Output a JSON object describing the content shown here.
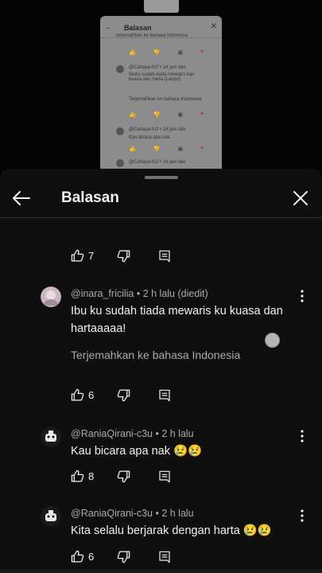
{
  "preview": {
    "title": "Balasan",
    "back_icon": "arrow-left-icon",
    "close_icon": "close-icon",
    "line_top": "terjemahkan ke bahasa Indonesia",
    "reply1_author": "@Cahaya-h1f • 14 jam lalu",
    "reply1_text": "Ibuku sudah tiada mewaris kan kuasa dan harta (Lanjut)",
    "reply1_translate": "Terjemahkan ke bahasa Indonesia",
    "reply2_author": "@Cahaya-h1f • 14 jam lalu",
    "reply2_text": "Kau bicara apa nak",
    "reply3_author": "@Cahaya-h1f • 14 jam lalu"
  },
  "sheet": {
    "title": "Balasan",
    "back_icon": "arrow-left-icon",
    "close_icon": "close-icon"
  },
  "top_actions": {
    "likes": "7"
  },
  "comments": [
    {
      "author": "@inara_fricilia • 2 h lalu (diedit)",
      "text": "Ibu ku sudah tiada mewaris ku kuasa dan hartaaaaa!",
      "translate": "Terjemahkan ke bahasa Indonesia",
      "likes": "6"
    },
    {
      "author": "@RaniaQirani-c3u • 2 h lalu",
      "text": "Kau bicara apa nak 😢😢",
      "likes": "8"
    },
    {
      "author": "@RaniaQirani-c3u • 2 h lalu",
      "text": "Kita selalu berjarak dengan harta 😢😢",
      "likes": "6"
    }
  ],
  "colors": {
    "background": "#0f0f0f",
    "text": "#f1f1f1",
    "secondary": "#aaaaaa"
  }
}
